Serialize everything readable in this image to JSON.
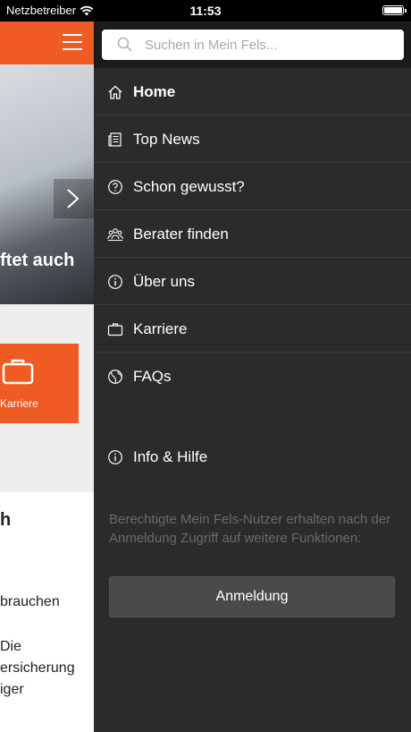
{
  "status_bar": {
    "carrier": "Netzbetreiber",
    "time": "11:53",
    "icons": [
      "wifi-icon",
      "battery-icon"
    ]
  },
  "background_app": {
    "hero_text": "ftet auch",
    "tile_label": "Karriere",
    "card_heading": "h",
    "card_lines": [
      "brauchen",
      "Die",
      "ersicherung",
      "iger"
    ]
  },
  "drawer": {
    "search": {
      "placeholder": "Suchen in Mein Fels..."
    },
    "menu": [
      {
        "label": "Home",
        "icon": "home-icon"
      },
      {
        "label": "Top News",
        "icon": "news-icon"
      },
      {
        "label": "Schon gewusst?",
        "icon": "question-icon"
      },
      {
        "label": "Berater finden",
        "icon": "people-icon"
      },
      {
        "label": "Über uns",
        "icon": "info-icon"
      },
      {
        "label": "Karriere",
        "icon": "briefcase-icon"
      },
      {
        "label": "FAQs",
        "icon": "globe-icon"
      }
    ],
    "info_item": {
      "label": "Info & Hilfe",
      "icon": "info-icon"
    },
    "login_note": "Berechtigte Mein Fels-Nutzer erhalten nach der Anmeldung Zugriff auf weitere Funktionen:",
    "login_button": "Anmeldung"
  },
  "colors": {
    "brand_orange": "#f05a23",
    "drawer_bg": "#2b2b2b",
    "search_zone_bg": "#1b1b1b"
  }
}
